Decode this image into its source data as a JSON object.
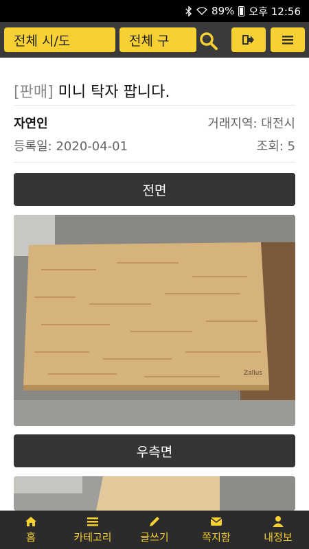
{
  "status_bar": {
    "battery": "89%",
    "time": "오후 12:56",
    "icons": [
      "bluetooth-icon",
      "wifi-icon",
      "battery-icon"
    ]
  },
  "topnav": {
    "city_select": "전체 시/도",
    "district_select": "전체 구",
    "icons": [
      "search-icon",
      "sign-out-icon",
      "hamburger-menu-icon"
    ]
  },
  "post": {
    "category": "[판매]",
    "title": "미니 탁자 팝니다.",
    "author": "자연인",
    "region_label": "거래지역: 대전시",
    "date_label": "등록일: 2020-04-01",
    "views_label": "조회: 5"
  },
  "sections": {
    "front_label": "전면",
    "right_label": "우측면"
  },
  "photo_brand": "Zallus",
  "tabbar": {
    "home": "홈",
    "category": "카테고리",
    "write": "글쓰기",
    "messages": "쪽지함",
    "profile": "내정보"
  },
  "colors": {
    "accent": "#f7d033",
    "dark": "#343434",
    "nav_bg": "#3a3a3a"
  }
}
